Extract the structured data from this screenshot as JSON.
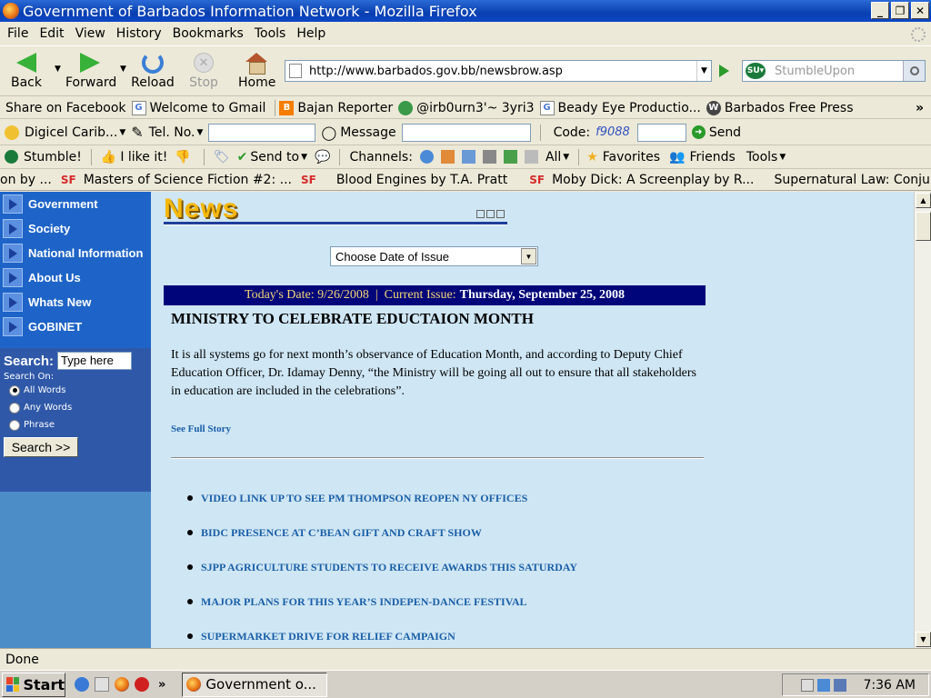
{
  "window": {
    "title": "Government of Barbados Information Network - Mozilla Firefox",
    "controls": [
      "_",
      "❐",
      "✕"
    ]
  },
  "menu": [
    "File",
    "Edit",
    "View",
    "History",
    "Bookmarks",
    "Tools",
    "Help"
  ],
  "nav": {
    "back": "Back",
    "forward": "Forward",
    "reload": "Reload",
    "stop": "Stop",
    "home": "Home",
    "url": "http://www.barbados.gov.bb/newsbrow.asp",
    "search_placeholder": "StumbleUpon"
  },
  "bookmarks": [
    {
      "label": "Share on Facebook",
      "icon": "facebook-icon",
      "color": "#3b5998"
    },
    {
      "label": "Welcome to Gmail",
      "icon": "google-icon",
      "color": "#4a7ad6"
    },
    {
      "label": "Bajan Reporter",
      "icon": "blogger-icon",
      "color": "#f57d00"
    },
    {
      "label": "@irb0urn3'~ 3yri3",
      "icon": "globe-icon",
      "color": "#3a9a4a"
    },
    {
      "label": "Beady Eye Productio...",
      "icon": "google-icon",
      "color": "#4a7ad6"
    },
    {
      "label": "Barbados Free Press",
      "icon": "wordpress-icon",
      "color": "#464646"
    }
  ],
  "bookmarks_more": "»",
  "digicel": {
    "name": "Digicel Carib...",
    "tel_label": "Tel. No.",
    "message_label": "Message",
    "code_label": "Code:",
    "code_value": "f9088",
    "send": "Send"
  },
  "stumble": {
    "stumble": "Stumble!",
    "like": "I like it!",
    "send_to": "Send to",
    "channels": "Channels:",
    "all": "All",
    "favorites": "Favorites",
    "friends": "Friends",
    "tools": "Tools"
  },
  "ticker": [
    "on by ...",
    "Masters of Science Fiction #2: ...",
    "Blood Engines by T.A. Pratt",
    "Moby Dick: A Screenplay by R...",
    "Supernatural Law: Conjural"
  ],
  "ticker_tag": "SF",
  "sidebar": {
    "items": [
      "Government",
      "Society",
      "National Information",
      "About Us",
      "Whats New",
      "GOBINET"
    ],
    "search_label": "Search:",
    "search_value": "Type here",
    "search_on": "Search On:",
    "options": [
      "All Words",
      "Any Words",
      "Phrase"
    ],
    "selected_option": 0,
    "search_button": "Search >>"
  },
  "content": {
    "logo": "News",
    "date_select": "Choose Date of Issue",
    "date_bar_prefix": "Today's Date: 9/26/2008  |  Current Issue:",
    "current_issue": "Thursday, September 25, 2008",
    "headline": "MINISTRY TO CELEBRATE EDUCTAION MONTH",
    "story": "It is all systems go for next month’s observance of Education Month, and according to Deputy Chief Education Officer, Dr. Idamay Denny, “the Ministry will be going all out to ensure that all stakeholders in education are included in the celebrations”.",
    "full_story": "See Full Story",
    "news_items": [
      "VIDEO LINK UP TO SEE PM THOMPSON REOPEN NY OFFICES",
      "BIDC PRESENCE AT C’BEAN GIFT AND CRAFT SHOW",
      "SJPP AGRICULTURE STUDENTS TO RECEIVE AWARDS THIS SATURDAY",
      "MAJOR PLANS FOR THIS YEAR’S INDEPEN-DANCE FESTIVAL",
      "SUPERMARKET DRIVE FOR RELIEF CAMPAIGN"
    ]
  },
  "status": "Done",
  "taskbar": {
    "start": "Start",
    "task": "Government o...",
    "more": "»",
    "clock": "7:36 AM"
  }
}
